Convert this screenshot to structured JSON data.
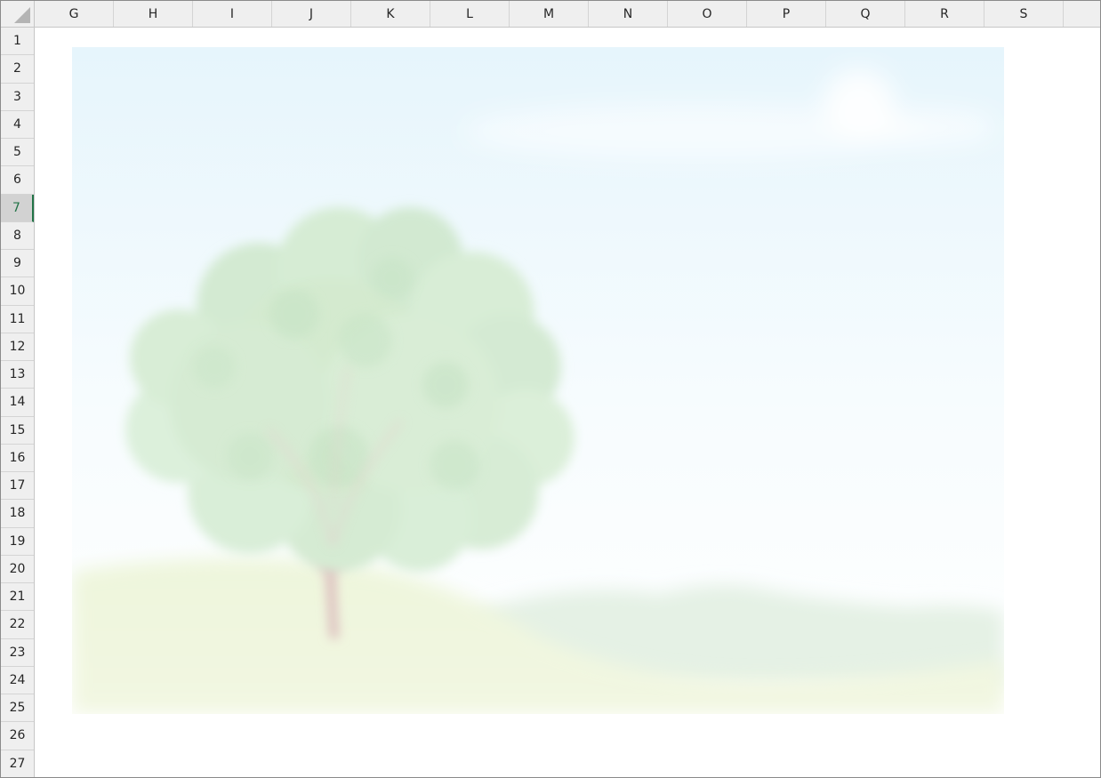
{
  "columns": [
    "G",
    "H",
    "I",
    "J",
    "K",
    "L",
    "M",
    "N",
    "O",
    "P",
    "Q",
    "R",
    "S"
  ],
  "rows": [
    "1",
    "2",
    "3",
    "4",
    "5",
    "6",
    "7",
    "8",
    "9",
    "10",
    "11",
    "12",
    "13",
    "14",
    "15",
    "16",
    "17",
    "18",
    "19",
    "20",
    "21",
    "22",
    "23",
    "24",
    "25",
    "26",
    "27"
  ],
  "active_row": "7",
  "picture": {
    "description_icon": "landscape-tree-picture",
    "colors": {
      "sky_top": "#e8f6fc",
      "sky_bottom": "#ffffff",
      "foliage": "#cfe9cf",
      "trunk": "#e2c4c4",
      "hill": "#eef5dc",
      "mountains": "#e3f0e4"
    }
  }
}
